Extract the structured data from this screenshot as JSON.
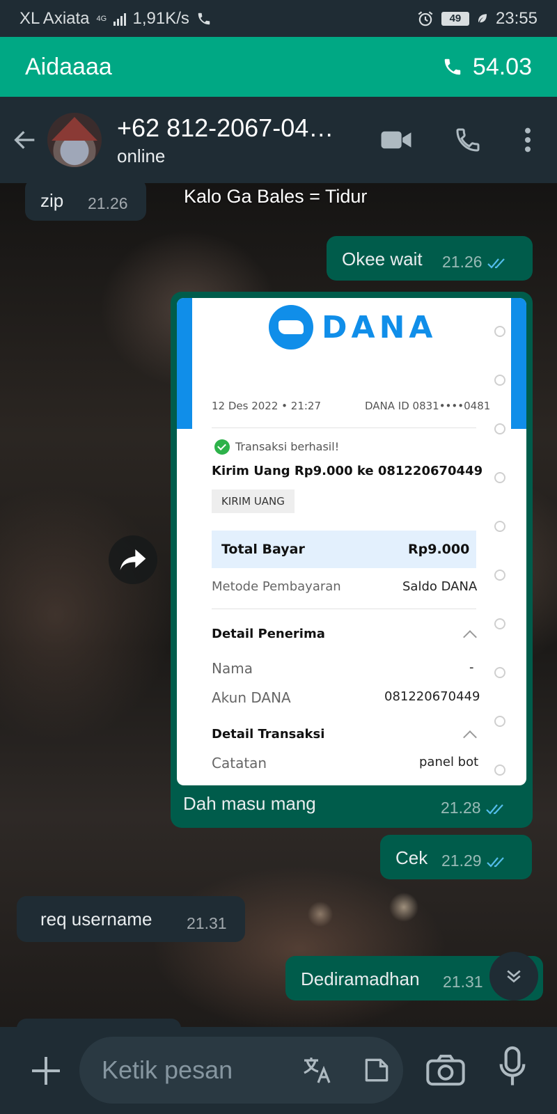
{
  "status_bar": {
    "carrier": "XL Axiata",
    "network": "4G",
    "speed": "1,91K/s",
    "battery": "49",
    "time": "23:55"
  },
  "call_banner": {
    "name": "Aidaaaa",
    "duration": "54.03"
  },
  "header": {
    "contact_name": "+62 812-2067-04…",
    "status": "online"
  },
  "chat": {
    "top_overlay_text": "Kalo Ga Bales = Tidur",
    "messages": [
      {
        "direction": "in",
        "text": "zip",
        "time": "21.26"
      },
      {
        "direction": "out",
        "text": "Okee wait",
        "time": "21.26",
        "read": true
      },
      {
        "direction": "out",
        "type": "image",
        "caption": "Dah masu mang",
        "time": "21.28",
        "read": true
      },
      {
        "direction": "out",
        "text": "Cek",
        "time": "21.29",
        "read": true
      },
      {
        "direction": "in",
        "text": "req username",
        "time": "21.31"
      },
      {
        "direction": "out",
        "text": "Dediramadhan",
        "time": "21.31",
        "read": true
      }
    ]
  },
  "receipt": {
    "logo": "DANA",
    "datetime": "12 Des 2022 • 21:27",
    "dana_id": "DANA ID 0831••••0481",
    "status": "Transaksi berhasil!",
    "title": "Kirim Uang Rp9.000 ke 081220670449",
    "chip": "KIRIM UANG",
    "total_label": "Total Bayar",
    "total_value": "Rp9.000",
    "method_label": "Metode Pembayaran",
    "method_value": "Saldo DANA",
    "recipient_heading": "Detail Penerima",
    "name_label": "Nama",
    "name_value": "-",
    "account_label": "Akun DANA",
    "account_value": "081220670449",
    "transaction_heading": "Detail Transaksi",
    "note_label": "Catatan",
    "note_value": "panel bot"
  },
  "input": {
    "placeholder": "Ketik pesan"
  },
  "colors": {
    "accent": "#00a884",
    "outgoing": "#005c4b",
    "incoming": "#1f2c34",
    "read_ticks": "#53bdeb",
    "dana_blue": "#108ee9"
  },
  "icons": [
    "back-arrow-icon",
    "video-call-icon",
    "voice-call-icon",
    "more-vert-icon",
    "forward-icon",
    "scroll-down-icon",
    "plus-icon",
    "translate-icon",
    "sticker-icon",
    "camera-icon",
    "mic-icon",
    "phone-icon",
    "alarm-icon"
  ]
}
